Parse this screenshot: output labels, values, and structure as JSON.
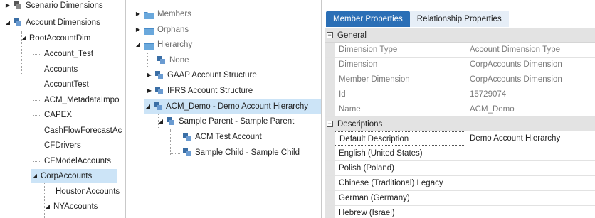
{
  "left_tree": {
    "scenario_dimensions": "Scenario Dimensions",
    "account_dimensions": "Account Dimensions",
    "root": "RootAccountDim",
    "items": [
      "Account_Test",
      "Accounts",
      "AccountTest",
      "ACM_MetadataImpo",
      "CAPEX",
      "CashFlowForecastAc",
      "CFDrivers",
      "CFModelAccounts",
      "CorpAccounts"
    ],
    "children": [
      "HoustonAccounts",
      "NYAccounts"
    ]
  },
  "mid_tree": {
    "members": "Members",
    "orphans": "Orphans",
    "hierarchy": "Hierarchy",
    "none": "None",
    "gaap": "GAAP Account Structure",
    "ifrs": "IFRS Account Structure",
    "acm_demo": "ACM_Demo - Demo Account Hierarchy",
    "sample_parent": "Sample Parent - Sample Parent",
    "acm_test": "ACM Test Account",
    "sample_child": "Sample Child - Sample Child"
  },
  "tabs": {
    "member_properties": "Member Properties",
    "relationship_properties": "Relationship Properties"
  },
  "general": {
    "title": "General",
    "rows": [
      {
        "name": "Dimension Type",
        "value": "Account Dimension Type"
      },
      {
        "name": "Dimension",
        "value": "CorpAccounts Dimension"
      },
      {
        "name": "Member Dimension",
        "value": "CorpAccounts Dimension"
      },
      {
        "name": "Id",
        "value": "15729074"
      },
      {
        "name": "Name",
        "value": "ACM_Demo"
      }
    ]
  },
  "descriptions": {
    "title": "Descriptions",
    "rows": [
      {
        "name": "Default Description",
        "value": "Demo Account Hierarchy"
      },
      {
        "name": "English (United States)",
        "value": ""
      },
      {
        "name": "Polish (Poland)",
        "value": ""
      },
      {
        "name": "Chinese (Traditional) Legacy",
        "value": ""
      },
      {
        "name": "German (Germany)",
        "value": ""
      },
      {
        "name": "Hebrew (Israel)",
        "value": ""
      }
    ]
  },
  "colors": {
    "tab_active": "#2b6fb6",
    "selection": "#cce4f7",
    "category_bg": "#e3e3e3"
  },
  "icons": {
    "dimension": "dimension-icon",
    "folder": "folder-icon",
    "expand": "expand-caret-icon",
    "collapse": "collapse-caret-icon"
  }
}
